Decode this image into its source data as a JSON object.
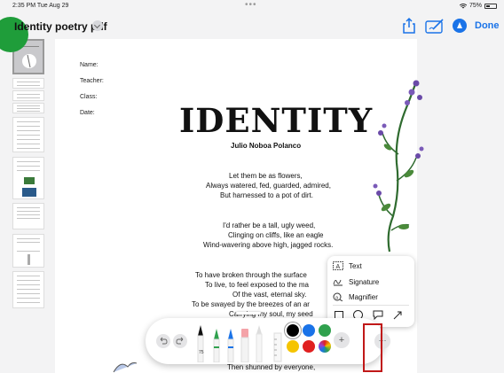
{
  "status_bar": {
    "time": "2:35 PM  Tue Aug 29",
    "dots": "•••",
    "battery": "75%"
  },
  "nav": {
    "title": "Identity poetry pdf",
    "done_label": "Done"
  },
  "page": {
    "fields": [
      "Name:",
      "Teacher:",
      "Class:",
      "Date:"
    ],
    "title": "IDENTITY",
    "author": "Julio Noboa Polanco",
    "stanzas": [
      [
        "Let them be as flowers,",
        "Always watered, fed, guarded, admired,",
        "But harnessed to a pot of dirt."
      ],
      [
        "I'd rather be a tall, ugly weed,",
        "Clinging on cliffs, like an eagle",
        "Wind-wavering above high, jagged rocks."
      ],
      [
        "To have broken through the surface",
        "To live, to feel exposed to the ma",
        "Of the vast, eternal sky.",
        "To be swayed by the breezes of an ar",
        "Carrying my soul, my seed"
      ]
    ],
    "last_line": "Then shunned by everyone,"
  },
  "insert_menu": {
    "items": [
      {
        "label": "Text",
        "icon": "text-box-icon"
      },
      {
        "label": "Signature",
        "icon": "signature-icon"
      },
      {
        "label": "Magnifier",
        "icon": "magnifier-icon"
      }
    ],
    "shapes": [
      "square-shape-icon",
      "circle-shape-icon",
      "speech-bubble-icon",
      "arrow-shape-icon"
    ]
  },
  "toolbar": {
    "colors": {
      "row1": [
        "#000000",
        "#1a73e8",
        "#30a14e"
      ],
      "row2": [
        "#f5c400",
        "#e02020",
        "multicolor"
      ]
    },
    "add_label": "+",
    "more_label": "···"
  }
}
